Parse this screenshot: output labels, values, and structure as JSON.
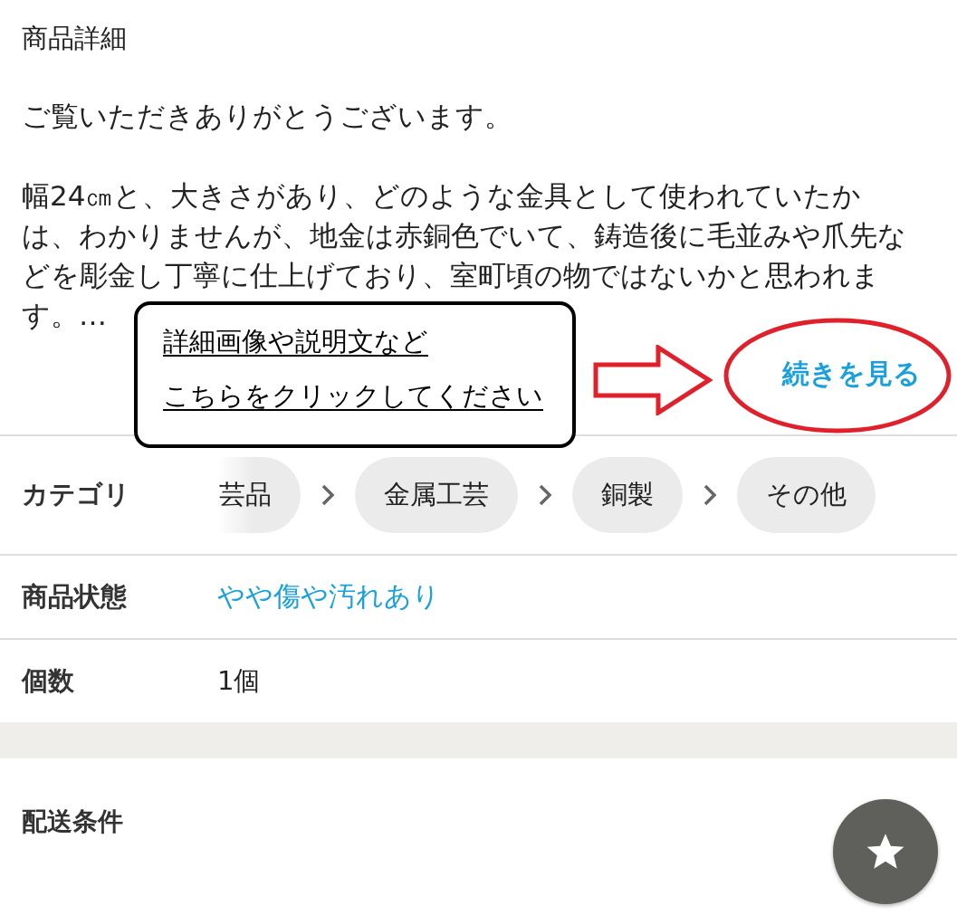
{
  "section_title": "商品詳細",
  "description": [
    "ご覧いただきありがとうございます。",
    "幅24㎝と、大きさがあり、どのような金具として使われていたかは、わかりませんが、地金は赤銅色でいて、鋳造後に毛並みや爪先などを彫金し丁寧に仕上げており、室町頃の物ではないかと思われます。…"
  ],
  "annotation": {
    "lines": [
      "詳細画像や説明文など",
      "こちらをクリックしてください"
    ]
  },
  "more_link": "続きを見る",
  "specs": [
    {
      "label": "カテゴリ",
      "kind": "breadcrumb",
      "items": [
        "芸品",
        "金属工芸",
        "銅製",
        "その他"
      ]
    },
    {
      "label": "商品状態",
      "kind": "link",
      "value": "やや傷や汚れあり"
    },
    {
      "label": "個数",
      "kind": "text",
      "value": "1個"
    }
  ],
  "shipping": {
    "title": "配送条件"
  }
}
